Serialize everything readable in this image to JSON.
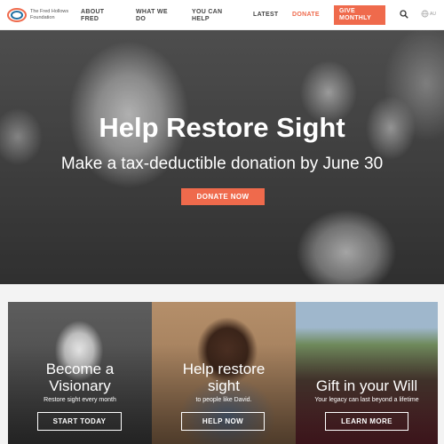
{
  "header": {
    "logo_text": "The Fred Hollows Foundation",
    "nav": [
      {
        "label": "ABOUT FRED"
      },
      {
        "label": "WHAT WE DO"
      },
      {
        "label": "YOU CAN HELP"
      },
      {
        "label": "LATEST"
      },
      {
        "label": "DONATE"
      }
    ],
    "give_monthly": "GIVE MONTHLY",
    "search_icon": "search-icon",
    "language_icon": "globe-icon",
    "language_label": "AU"
  },
  "hero": {
    "title": "Help Restore Sight",
    "subtitle": "Make a tax-deductible donation by June 30",
    "button": "DONATE NOW"
  },
  "cards": [
    {
      "title_line1": "Become a",
      "title_line2": "Visionary",
      "subtitle": "Restore sight every month",
      "button": "START TODAY"
    },
    {
      "title_line1": "Help restore",
      "title_line2": "sight",
      "subtitle": "to people like David.",
      "button": "HELP NOW"
    },
    {
      "title_line1": "Gift in your Will",
      "subtitle": "Your legacy can last beyond a lifetime",
      "button": "LEARN MORE"
    }
  ],
  "colors": {
    "accent": "#ef6a4c",
    "logo_blue": "#1f6fa3"
  }
}
